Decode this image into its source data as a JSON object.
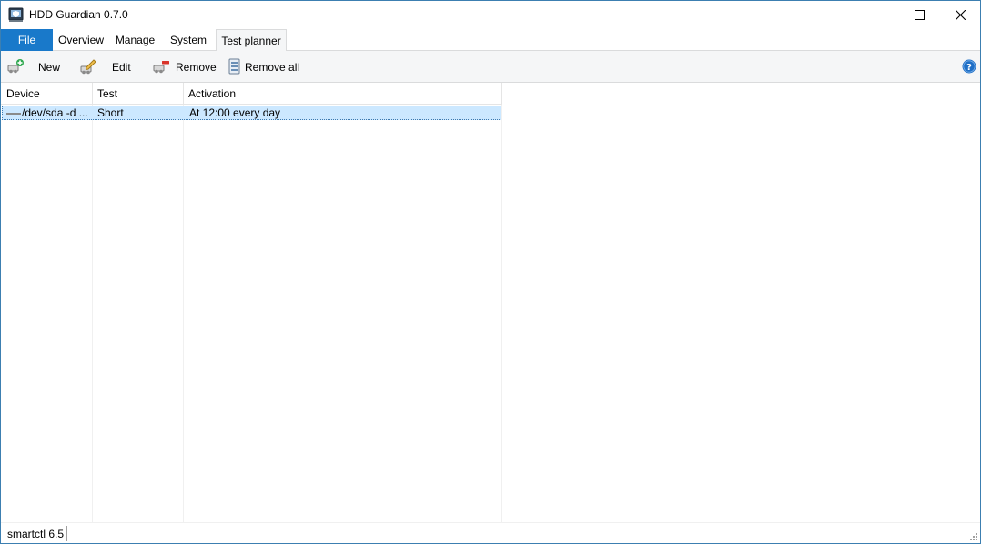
{
  "window": {
    "title": "HDD Guardian 0.7.0",
    "icons": {
      "app": "drive-shield-icon",
      "minimize": "minimize-icon",
      "maximize": "maximize-icon",
      "close": "close-icon"
    }
  },
  "tabs": [
    {
      "label": "File",
      "active": false,
      "highlight": true
    },
    {
      "label": "Overview",
      "active": false
    },
    {
      "label": "Manage",
      "active": false
    },
    {
      "label": "System",
      "active": false
    },
    {
      "label": "Test planner",
      "active": true
    }
  ],
  "toolbar": {
    "new_label": "New",
    "edit_label": "Edit",
    "remove_label": "Remove",
    "remove_all_label": "Remove all",
    "icons": {
      "new": "add-task-icon",
      "edit": "edit-task-icon",
      "remove": "remove-task-icon",
      "remove_all": "remove-all-icon",
      "help": "help-icon"
    }
  },
  "list": {
    "columns": [
      "Device",
      "Test",
      "Activation"
    ],
    "rows": [
      {
        "device": "/dev/sda -d ...",
        "test": "Short",
        "activation": "At 12:00 every day",
        "selected": true
      }
    ]
  },
  "statusbar": {
    "text": "smartctl 6.5"
  },
  "colors": {
    "accent": "#1979ca",
    "selection": "#cce8ff",
    "toolbar_bg": "#f5f6f7",
    "help": "#1f6fc6"
  }
}
